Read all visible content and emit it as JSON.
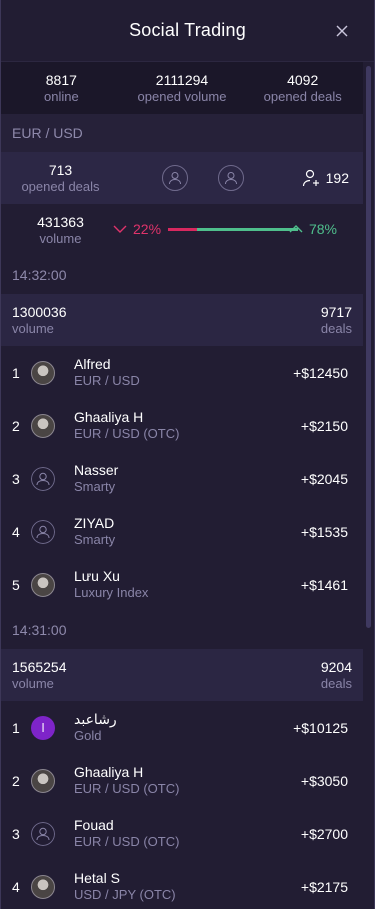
{
  "header": {
    "title": "Social Trading",
    "close_icon": "close-icon"
  },
  "global_stats": [
    {
      "value": "8817",
      "label": "online"
    },
    {
      "value": "2111294",
      "label": "opened volume"
    },
    {
      "value": "4092",
      "label": "opened deals"
    }
  ],
  "pair": {
    "name": "EUR / USD",
    "opened_deals": {
      "value": "713",
      "label": "opened deals"
    },
    "followers": "192",
    "volume": {
      "value": "431363",
      "label": "volume"
    },
    "down_pct": "22%",
    "up_pct": "78%",
    "down_fraction": 0.22,
    "colors": {
      "down": "#e0336b",
      "up": "#4fbf8c"
    }
  },
  "rounds": [
    {
      "time": "14:32:00",
      "volume": {
        "value": "1300036",
        "label": "volume"
      },
      "deals": {
        "value": "9717",
        "label": "deals"
      },
      "traders": [
        {
          "rank": "1",
          "name": "Alfred",
          "asset": "EUR / USD",
          "profit": "+$12450",
          "avatar": "photo"
        },
        {
          "rank": "2",
          "name": "Ghaaliya H",
          "asset": "EUR / USD (OTC)",
          "profit": "+$2150",
          "avatar": "photo"
        },
        {
          "rank": "3",
          "name": "Nasser",
          "asset": "Smarty",
          "profit": "+$2045",
          "avatar": "user-outline-icon"
        },
        {
          "rank": "4",
          "name": "ZIYAD",
          "asset": "Smarty",
          "profit": "+$1535",
          "avatar": "user-outline-icon"
        },
        {
          "rank": "5",
          "name": "Lưu Xu",
          "asset": "Luxury Index",
          "profit": "+$1461",
          "avatar": "photo"
        }
      ]
    },
    {
      "time": "14:31:00",
      "volume": {
        "value": "1565254",
        "label": "volume"
      },
      "deals": {
        "value": "9204",
        "label": "deals"
      },
      "traders": [
        {
          "rank": "1",
          "name": "رشاعبد",
          "asset": "Gold",
          "profit": "+$10125",
          "avatar": "letter",
          "letter": "ا"
        },
        {
          "rank": "2",
          "name": "Ghaaliya H",
          "asset": "EUR / USD (OTC)",
          "profit": "+$3050",
          "avatar": "photo"
        },
        {
          "rank": "3",
          "name": "Fouad",
          "asset": "EUR / USD (OTC)",
          "profit": "+$2700",
          "avatar": "user-outline-icon"
        },
        {
          "rank": "4",
          "name": "Hetal S",
          "asset": "USD / JPY (OTC)",
          "profit": "+$2175",
          "avatar": "photo"
        }
      ]
    }
  ]
}
